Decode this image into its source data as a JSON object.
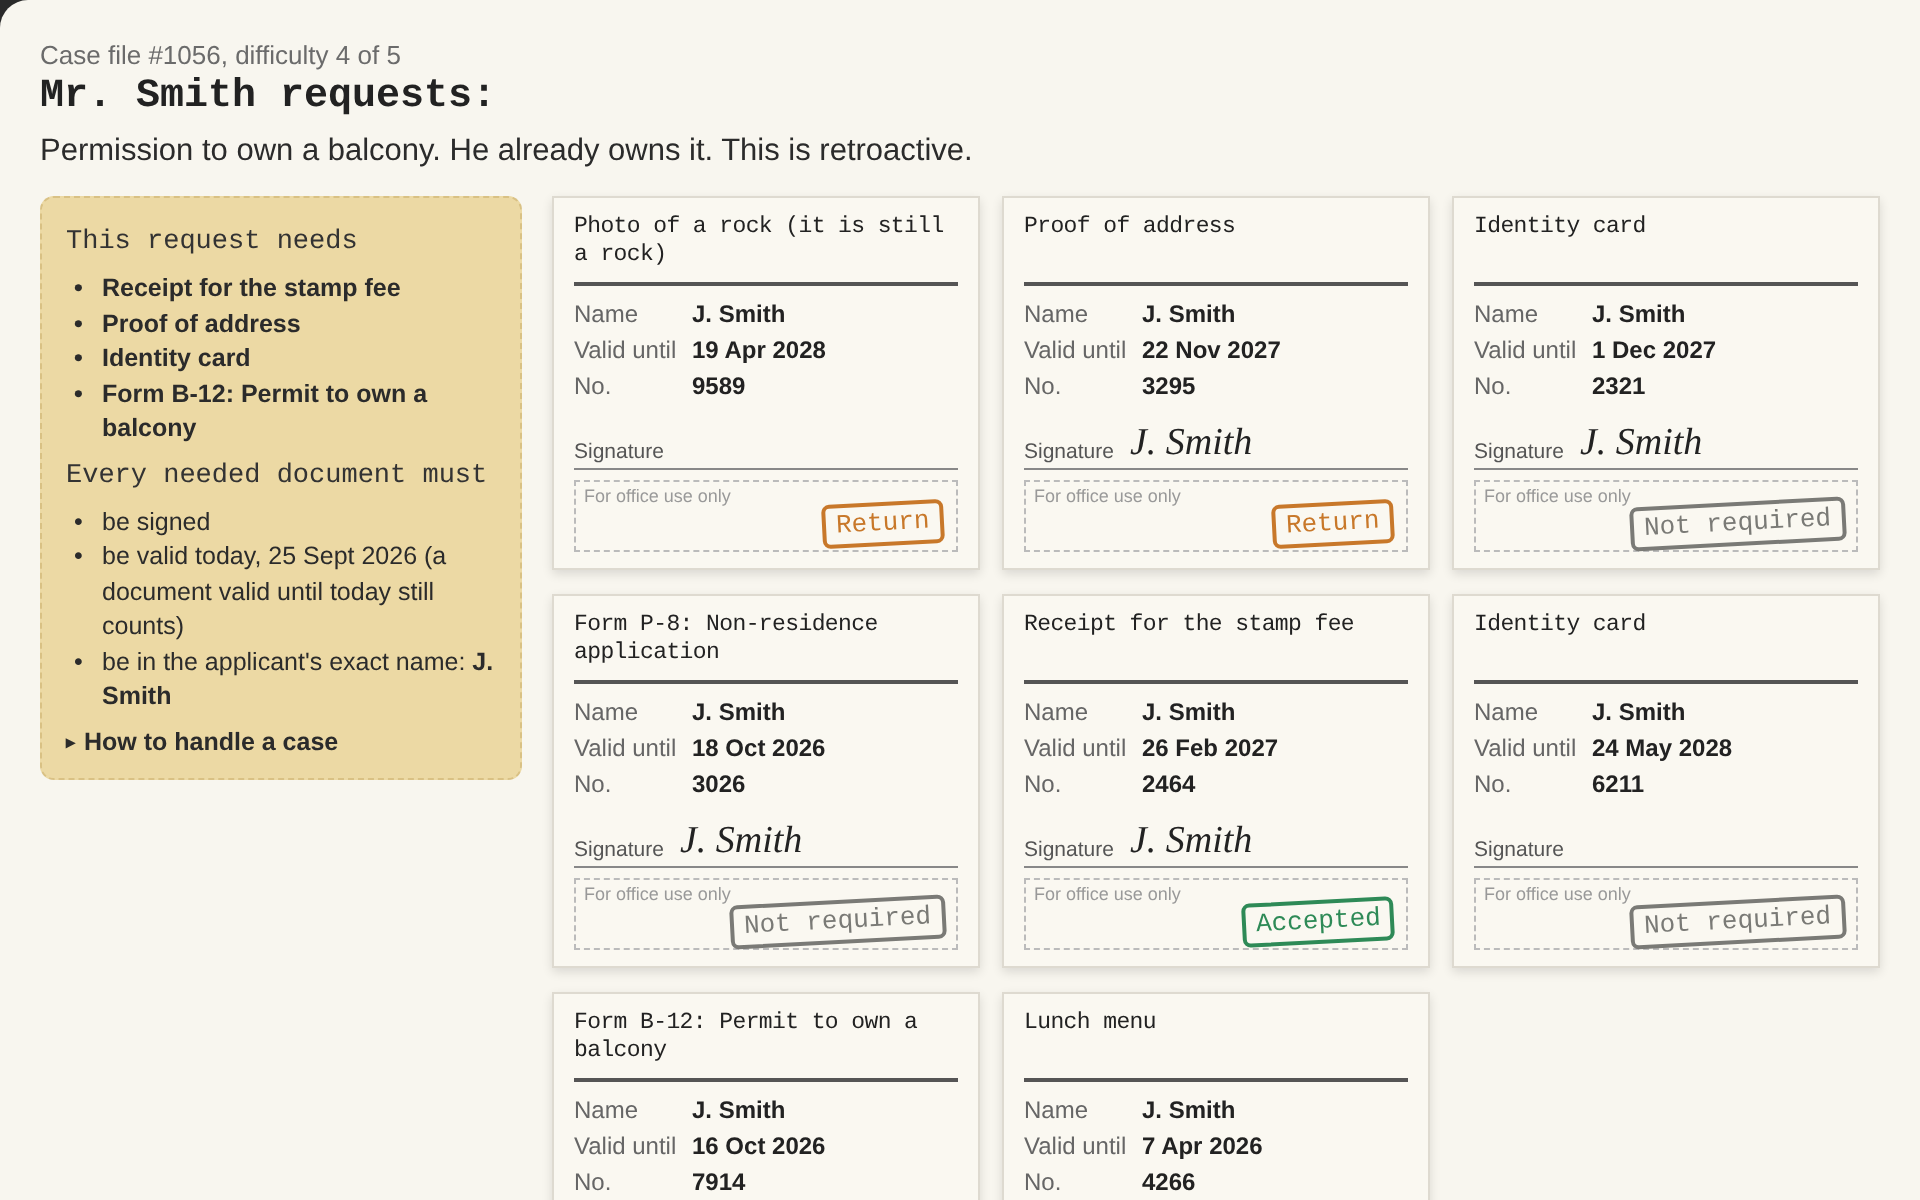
{
  "case_line": "Case file #1056, difficulty 4 of 5",
  "title": "Mr. Smith requests:",
  "description": "Permission to own a balcony. He already owns it. This is retroactive.",
  "rules": {
    "bullet": "•",
    "needs_heading": "This request needs",
    "needs": [
      "Receipt for the stamp fee",
      "Proof of address",
      "Identity card",
      "Form B-12: Permit to own a balcony"
    ],
    "must_heading": "Every needed document must",
    "must": [
      "be signed",
      "be valid today, 25 Sept 2026 (a document valid until today still counts)",
      "be in the applicant's exact name: **J. Smith**"
    ],
    "help": {
      "marker": "▸",
      "label": "How to handle a case",
      "expanded": false
    }
  },
  "documents": [
    {
      "title": "Photo of a rock (it is still a rock)",
      "fields": [
        {
          "label": "Name",
          "value": "J. Smith"
        },
        {
          "label": "Valid until",
          "value": "19 Apr 2028"
        },
        {
          "label": "No.",
          "value": "9589"
        }
      ],
      "signature": {
        "label": "Signature"
      },
      "office": {
        "label": "For office use only",
        "stamp": {
          "kind": "return",
          "text": "Return"
        }
      }
    },
    {
      "title": "Proof of address",
      "fields": [
        {
          "label": "Name",
          "value": "J. Smith"
        },
        {
          "label": "Valid until",
          "value": "22 Nov 2027"
        },
        {
          "label": "No.",
          "value": "3295"
        }
      ],
      "signature": {
        "label": "Signature",
        "text": "J. Smith"
      },
      "office": {
        "label": "For office use only",
        "stamp": {
          "kind": "return",
          "text": "Return"
        }
      }
    },
    {
      "title": "Identity card",
      "fields": [
        {
          "label": "Name",
          "value": "J. Smith"
        },
        {
          "label": "Valid until",
          "value": "1 Dec 2027"
        },
        {
          "label": "No.",
          "value": "2321"
        }
      ],
      "signature": {
        "label": "Signature",
        "text": "J. Smith"
      },
      "office": {
        "label": "For office use only",
        "stamp": {
          "kind": "not_required",
          "text": "Not required"
        }
      }
    },
    {
      "title": "Form P-8: Non-residence application",
      "fields": [
        {
          "label": "Name",
          "value": "J. Smith"
        },
        {
          "label": "Valid until",
          "value": "18 Oct 2026"
        },
        {
          "label": "No.",
          "value": "3026"
        }
      ],
      "signature": {
        "label": "Signature",
        "text": "J. Smith"
      },
      "office": {
        "label": "For office use only",
        "stamp": {
          "kind": "not_required",
          "text": "Not required"
        }
      }
    },
    {
      "title": "Receipt for the stamp fee",
      "fields": [
        {
          "label": "Name",
          "value": "J. Smith"
        },
        {
          "label": "Valid until",
          "value": "26 Feb 2027"
        },
        {
          "label": "No.",
          "value": "2464"
        }
      ],
      "signature": {
        "label": "Signature",
        "text": "J. Smith"
      },
      "office": {
        "label": "For office use only",
        "stamp": {
          "kind": "accepted",
          "text": "Accepted"
        }
      }
    },
    {
      "title": "Identity card",
      "fields": [
        {
          "label": "Name",
          "value": "J. Smith"
        },
        {
          "label": "Valid until",
          "value": "24 May 2028"
        },
        {
          "label": "No.",
          "value": "6211"
        }
      ],
      "signature": {
        "label": "Signature"
      },
      "office": {
        "label": "For office use only",
        "stamp": {
          "kind": "not_required",
          "text": "Not required"
        }
      }
    },
    {
      "title": "Form B-12: Permit to own a balcony",
      "fields": [
        {
          "label": "Name",
          "value": "J. Smith"
        },
        {
          "label": "Valid until",
          "value": "16 Oct 2026"
        },
        {
          "label": "No.",
          "value": "7914"
        }
      ]
    },
    {
      "title": "Lunch menu",
      "fields": [
        {
          "label": "Name",
          "value": "J. Smith"
        },
        {
          "label": "Valid until",
          "value": "7 Apr 2026"
        },
        {
          "label": "No.",
          "value": "4266"
        }
      ]
    }
  ]
}
